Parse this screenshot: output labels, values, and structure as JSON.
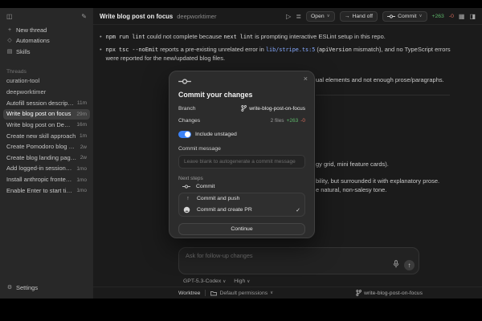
{
  "colors": {
    "accent": "#3b82f6",
    "added": "#5db56a",
    "removed": "#d16a5a"
  },
  "icons": {
    "sidebar_toggle": "◫",
    "compose": "✎",
    "new_thread": "+",
    "automations": "◇",
    "skills": "▤",
    "settings": "⚙",
    "play": "▷",
    "terminal": "≣",
    "handoff": "→",
    "chevron": "∨",
    "layout": "▦",
    "panel_right": "◨",
    "check": "✓",
    "arrow_up": "↑",
    "dot": "•",
    "close": "×",
    "push": "↑"
  },
  "titlebar": {
    "title": "Write blog post on focus",
    "project": "deepworktimer",
    "open": "Open",
    "handoff": "Hand off",
    "commit": "Commit",
    "added": "+263",
    "removed": "-0"
  },
  "sidebar": {
    "nav": [
      {
        "label": "New thread"
      },
      {
        "label": "Automations"
      },
      {
        "label": "Skills"
      }
    ],
    "section": "Threads",
    "groups": [
      {
        "label": "curation-tool"
      },
      {
        "label": "deepworktimer"
      }
    ],
    "threads": [
      {
        "label": "Autofill session description",
        "time": "11m"
      },
      {
        "label": "Write blog post on focus",
        "time": "29m"
      },
      {
        "label": "Write blog post on Deep Wor",
        "time": "16m"
      },
      {
        "label": "Create new skill approach",
        "time": "1m"
      },
      {
        "label": "Create Pomodoro blog post",
        "time": "2w"
      },
      {
        "label": "Create blog landing page and foc",
        "time": "2w"
      },
      {
        "label": "Add logged-in session heatmap",
        "time": "1mo"
      },
      {
        "label": "Install anthropic frontend skill",
        "time": "1mo"
      },
      {
        "label": "Enable Enter to start timer",
        "time": "1mo"
      }
    ],
    "settings": "Settings"
  },
  "main": {
    "bullets": {
      "b1": {
        "p1": "npm run lint",
        "p2": " could not complete because ",
        "p3": "next lint",
        "p4": " is prompting interactive ESLint setup in this repo."
      },
      "b2": {
        "p1": "npx tsc --noEmit",
        "p2": " reports a pre-existing unrelated error in ",
        "p3": "lib/stripe.ts:5",
        "p4": " (",
        "p5": "apiVersion",
        "p6": " mismatch), and no TypeScript errors were reported for the new/updated blog files."
      }
    },
    "fragments": {
      "f1": "ual elements and not enough prose/paragraphs.",
      "f2": "gy grid, mini feature cards).",
      "f3": "bility, but surrounded it with explanatory prose.",
      "f4": "e natural, non-salesy tone."
    }
  },
  "modal": {
    "title": "Commit your changes",
    "branch_label": "Branch",
    "branch_value": "write-blog-post-on-focus",
    "changes_label": "Changes",
    "files": "2 files",
    "added": "+263",
    "removed": "-0",
    "toggle": "Include unstaged",
    "message_label": "Commit message",
    "message_placeholder": "Leave blank to autogenerate a commit message",
    "next_steps": "Next steps",
    "opt_commit": "Commit",
    "opt_push": "Commit and push",
    "opt_pr": "Commit and create PR",
    "continue": "Continue"
  },
  "composer": {
    "placeholder": "Ask for follow-up changes",
    "model": "GPT-5.3-Codex",
    "effort": "High"
  },
  "statusbar": {
    "worktree": "Worktree",
    "permissions": "Default permissions",
    "branch": "write-blog-post-on-focus"
  }
}
